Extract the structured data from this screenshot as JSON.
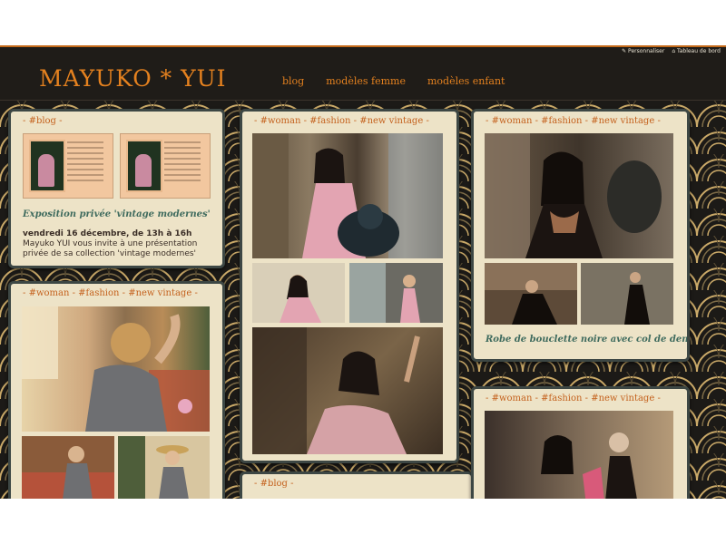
{
  "admin": {
    "customize": "Personnaliser",
    "dashboard": "Tableau de bord"
  },
  "site": {
    "logo": "MAYUKO * YUI"
  },
  "nav": {
    "items": [
      "blog",
      "modèles femme",
      "modèles enfant"
    ]
  },
  "tags": {
    "blog": [
      "#blog"
    ],
    "fashion": [
      "#woman",
      "#fashion",
      "#new vintage"
    ]
  },
  "post_blog": {
    "title": "Exposition privée 'vintage modernes'",
    "date_line": "vendredi 16 décembre, de 13h à 16h",
    "text": "Mayuko YUI vous invite à une présentation privée de sa collection 'vintage modernes'"
  },
  "post_lace": {
    "title": "Robe de bouclette noire avec col de dentelle"
  },
  "colors": {
    "accent": "#e4811f",
    "card_bg": "#ede3c7",
    "card_border": "#3d4744",
    "title_green": "#3f6b5e",
    "tag_orange": "#c4611d"
  }
}
